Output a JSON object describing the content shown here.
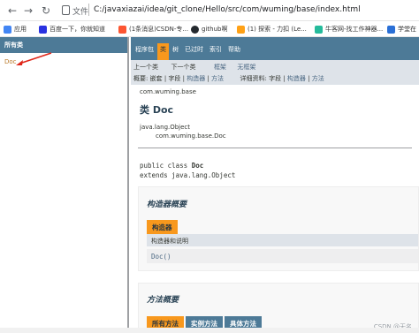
{
  "browser": {
    "scheme_label": "文件",
    "url": "C:/javaxiazai/idea/git_clone/Hello/src/com/wuming/base/index.html"
  },
  "bookmarks": [
    {
      "label": "应用",
      "color": "#4285f4"
    },
    {
      "label": "百度一下，你就知道",
      "color": "#2932e1"
    },
    {
      "label": "(1条消息)CSDN-专...",
      "color": "#fc5531"
    },
    {
      "label": "github啊",
      "color": "#24292e"
    },
    {
      "label": "(1) 探索 - 力扣 (Le...",
      "color": "#ffa116"
    },
    {
      "label": "牛客网-找工作神器...",
      "color": "#25bb9b"
    },
    {
      "label": "学堂在",
      "color": "#2a6fd6"
    }
  ],
  "left_frame": {
    "heading": "所有类",
    "class_link": "Doc",
    "arrow_color": "#e0271a"
  },
  "top_nav": {
    "items": [
      {
        "label": "程序包",
        "active": false
      },
      {
        "label": "类",
        "active": true
      },
      {
        "label": "树",
        "active": false
      },
      {
        "label": "已过时",
        "active": false
      },
      {
        "label": "索引",
        "active": false
      },
      {
        "label": "帮助",
        "active": false
      }
    ]
  },
  "sub_nav": {
    "prev_class": "上一个类",
    "next_class": "下一个类",
    "frames": "框架",
    "no_frames": "无框架",
    "summary_prefix": "概要: ",
    "summary_nested": "嵌套",
    "summary_field": "字段",
    "summary_constr": "构造器",
    "summary_method": "方法",
    "detail_prefix": "详细资料: ",
    "detail_field": "字段",
    "detail_constr": "构造器",
    "detail_method": "方法",
    "divider": " | "
  },
  "class_header": {
    "package": "com.wuming.base",
    "title": "类 Doc",
    "inheritance_parent": "java.lang.Object",
    "inheritance_child": "com.wuming.base.Doc"
  },
  "declaration": {
    "line1_prefix": "public class ",
    "line1_name": "Doc",
    "line2": "extends java.lang.Object"
  },
  "constructor_summary": {
    "title": "构造器概要",
    "caption": "构造器",
    "header": "构造器和说明",
    "row": "Doc()"
  },
  "method_summary": {
    "title": "方法概要",
    "tabs": [
      {
        "label": "所有方法",
        "active": true
      },
      {
        "label": "实例方法",
        "active": false
      },
      {
        "label": "具体方法",
        "active": false
      }
    ]
  },
  "watermark": "CSDN @无名"
}
